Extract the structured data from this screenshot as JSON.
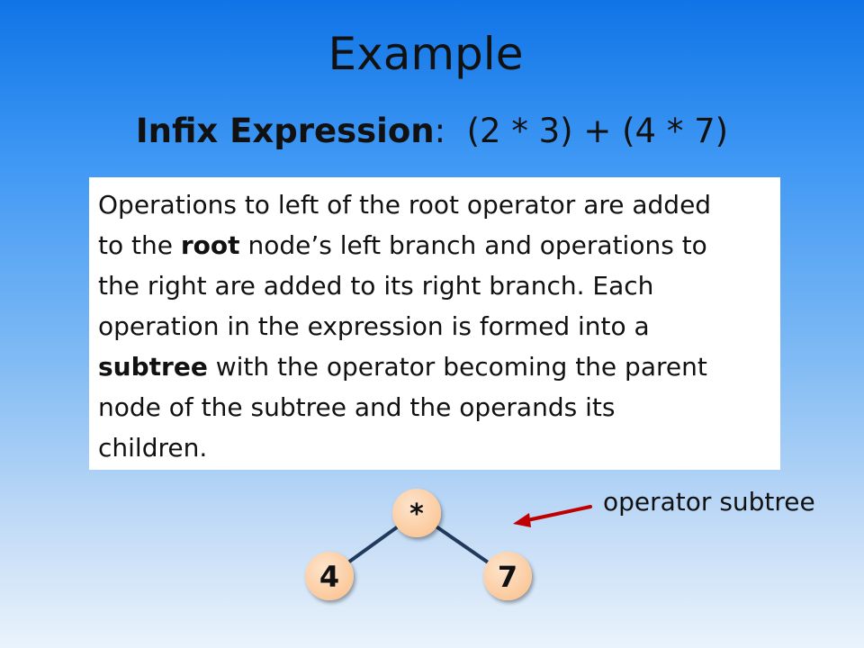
{
  "slide": {
    "title": "Example",
    "subtitle": {
      "label": "Infix Expression",
      "colon": ":",
      "expression": "(2 * 3) + (4 * 7)"
    },
    "description": {
      "lines": [
        [
          "Operations to left of the root operator are added"
        ],
        [
          "to the ",
          {
            "bold": "root"
          },
          " node’s left branch and operations to"
        ],
        [
          "the right are added to its right branch. Each"
        ],
        [
          "operation in the expression is formed into a"
        ],
        [
          {
            "bold": "subtree"
          },
          " with the operator becoming the parent"
        ],
        [
          "node of the subtree and the operands its"
        ],
        [
          "children."
        ]
      ]
    },
    "annotation": "operator subtree"
  },
  "tree": {
    "root": "*",
    "left_child": "4",
    "right_child": "7",
    "edge_color": "#1f3a5a",
    "node_fill": "#fbc89a",
    "node_fill_light": "#fde4cc",
    "arrow_color": "#c00000"
  }
}
